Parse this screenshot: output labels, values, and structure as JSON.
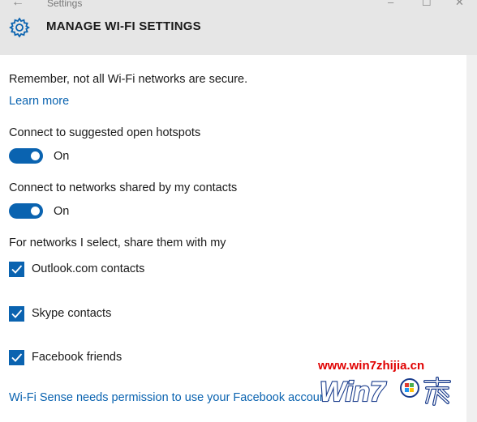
{
  "window": {
    "title": "Settings",
    "back_icon": "back-arrow-icon",
    "min_glyph": "–",
    "max_glyph": "☐",
    "close_glyph": "✕"
  },
  "header": {
    "icon": "gear-icon",
    "title": "MANAGE WI-FI SETTINGS"
  },
  "notice": {
    "text": "Remember, not all Wi-Fi networks are secure.",
    "link": "Learn more"
  },
  "toggles": [
    {
      "label": "Connect to suggested open hotspots",
      "state_label": "On",
      "on": true
    },
    {
      "label": "Connect to networks shared by my contacts",
      "state_label": "On",
      "on": true
    }
  ],
  "share": {
    "label": "For networks I select, share them with my",
    "options": [
      {
        "label": "Outlook.com contacts",
        "checked": true
      },
      {
        "label": "Skype contacts",
        "checked": true
      },
      {
        "label": "Facebook friends",
        "checked": true
      }
    ]
  },
  "footer": {
    "link": "Wi-Fi Sense needs permission to use your Facebook account"
  },
  "watermark": {
    "url": "www.win7zhijia.cn",
    "logo_text": "Win7"
  },
  "colors": {
    "accent": "#0a63b0",
    "header_bg": "#e6e6e6",
    "watermark_red": "#e00000"
  }
}
